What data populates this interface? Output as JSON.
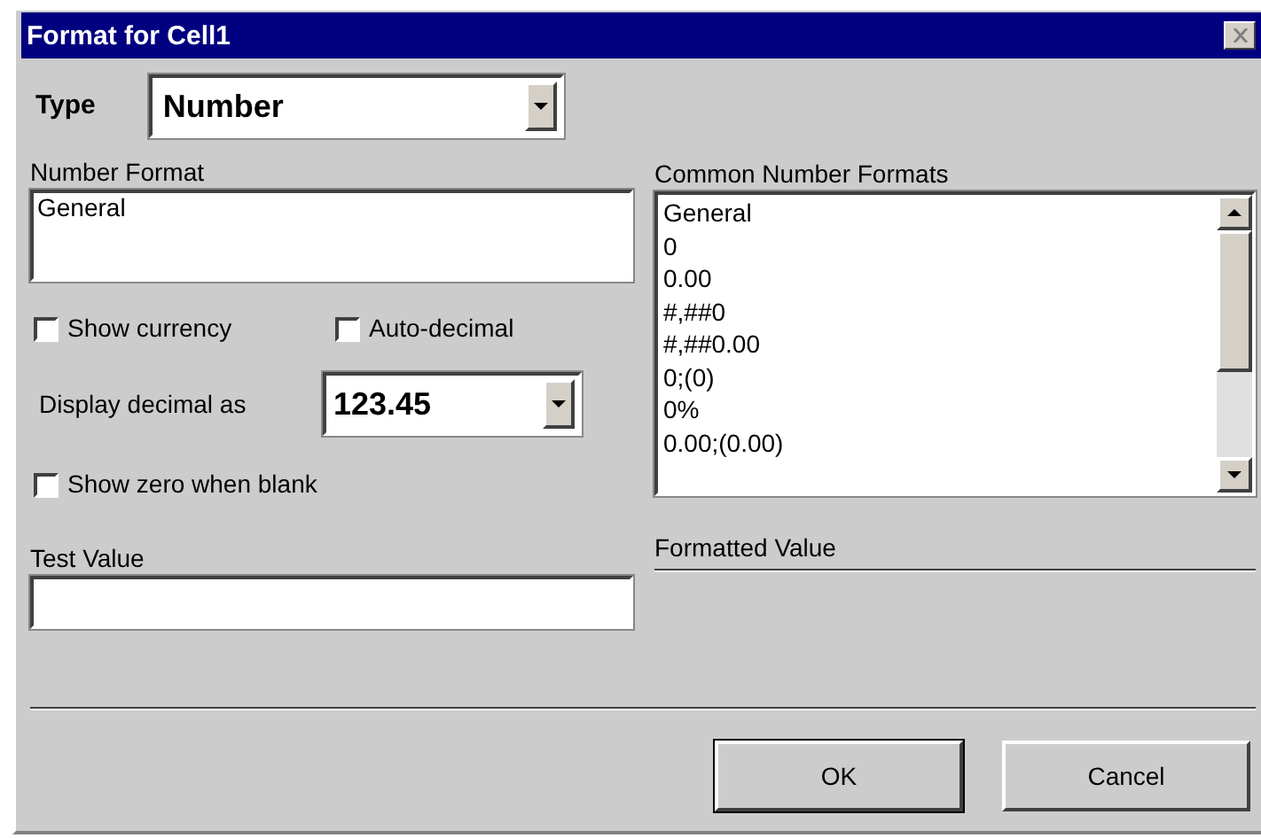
{
  "window": {
    "title": "Format for Cell1"
  },
  "type": {
    "label": "Type",
    "value": "Number"
  },
  "number_format": {
    "label": "Number Format",
    "value": "General"
  },
  "checkboxes": [
    {
      "label": "Show currency",
      "checked": false
    },
    {
      "label": "Auto-decimal",
      "checked": false
    }
  ],
  "display_decimal": {
    "label": "Display decimal as",
    "value": "123.45"
  },
  "show_zero": {
    "label": "Show zero when blank",
    "checked": false
  },
  "common_formats": {
    "label": "Common Number Formats",
    "items": [
      {
        "label": "General",
        "selected": false
      },
      {
        "label": "0",
        "selected": false
      },
      {
        "label": "0.00",
        "selected": false
      },
      {
        "label": "#,##0",
        "selected": false
      },
      {
        "label": "#,##0.00",
        "selected": false
      },
      {
        "label": "0;(0)",
        "selected": false
      },
      {
        "label": "0%",
        "selected": false
      },
      {
        "label": "0.00;(0.00)",
        "selected": false
      }
    ]
  },
  "test_value": {
    "label": "Test Value"
  },
  "formatted_value": {
    "label": "Formatted Value"
  },
  "buttons": [
    {
      "label": "OK",
      "default": true
    },
    {
      "label": "Cancel",
      "default": false
    }
  ]
}
